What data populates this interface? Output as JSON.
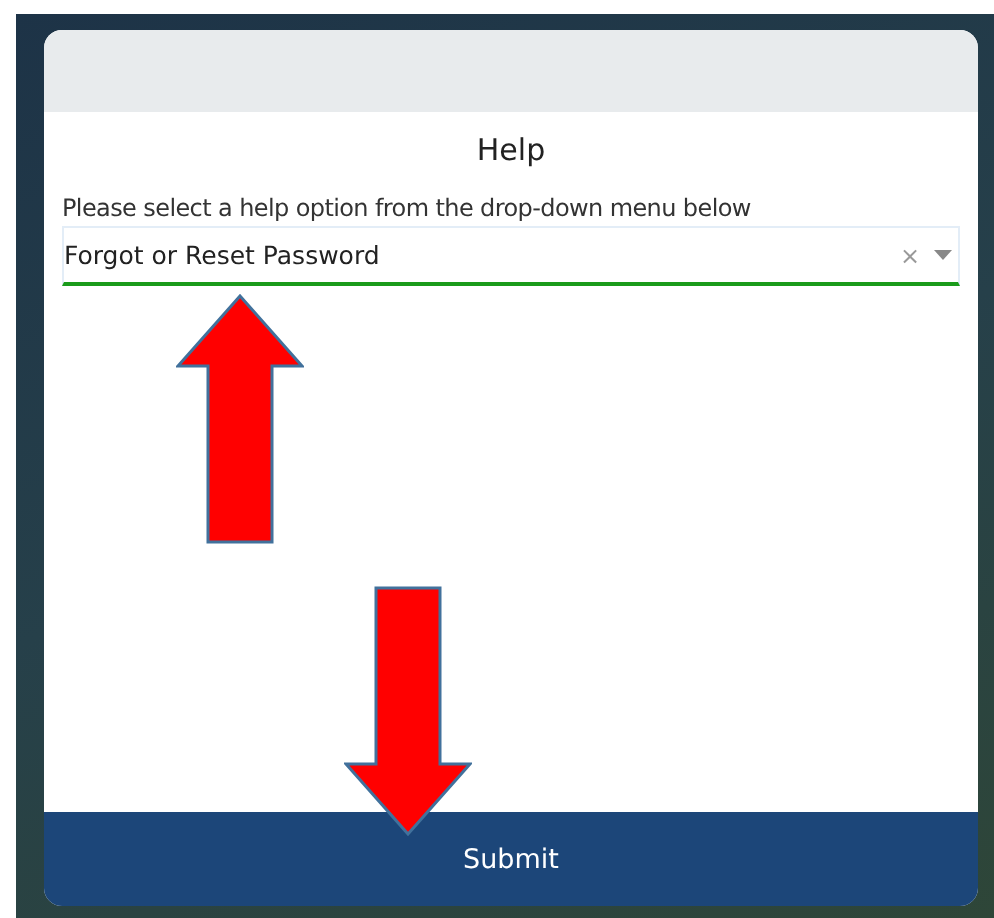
{
  "dialog": {
    "title": "Help",
    "prompt": "Please select a help option from the drop-down menu below",
    "select": {
      "value": "Forgot or Reset Password",
      "clear": "×"
    },
    "submit": "Submit"
  },
  "annotations": [
    {
      "kind": "arrow-up"
    },
    {
      "kind": "arrow-down"
    }
  ]
}
